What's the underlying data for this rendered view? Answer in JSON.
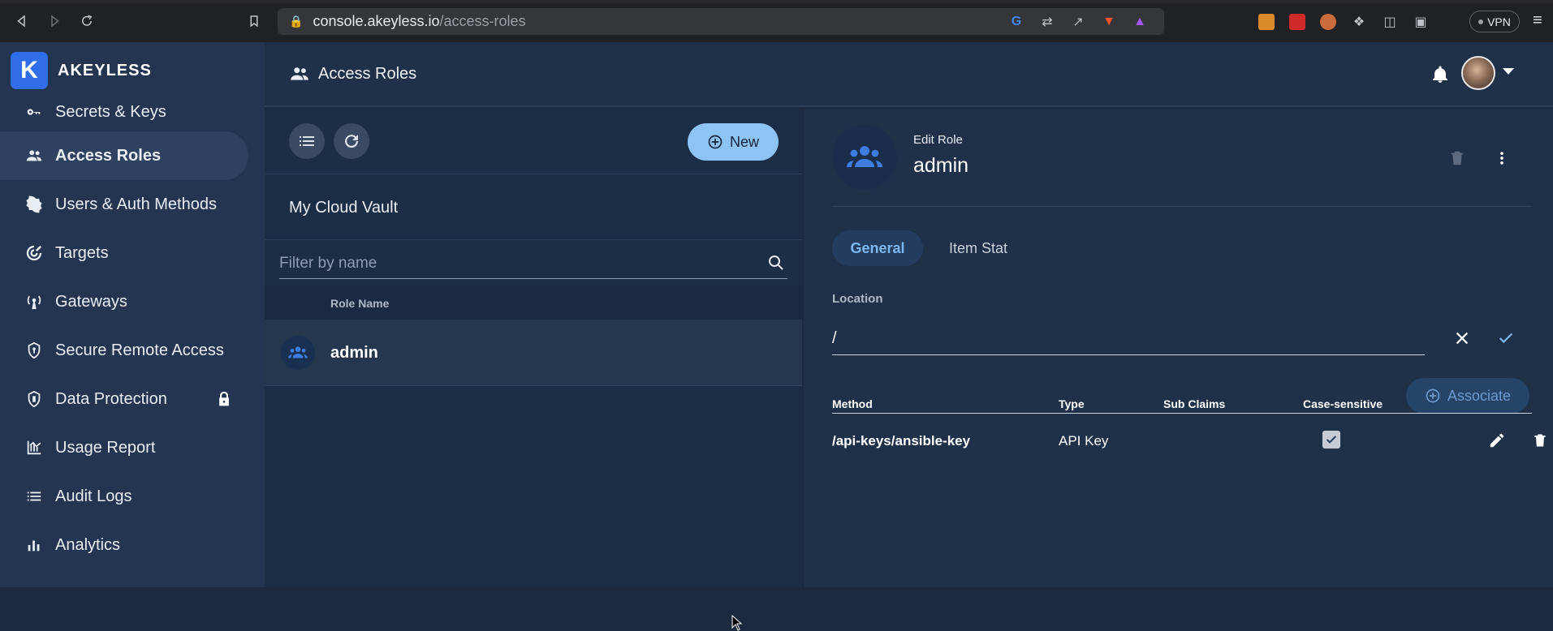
{
  "browser": {
    "url_host": "console.akeyless.io",
    "url_path": "/access-roles",
    "vpn_label": "VPN"
  },
  "brand": {
    "logo_letter": "K",
    "name": "AKEYLESS"
  },
  "sidebar": {
    "items": [
      {
        "label": "Secrets & Keys",
        "icon": "key-icon"
      },
      {
        "label": "Access Roles",
        "icon": "people-icon",
        "active": true
      },
      {
        "label": "Users & Auth Methods",
        "icon": "user-badge-icon"
      },
      {
        "label": "Targets",
        "icon": "target-icon"
      },
      {
        "label": "Gateways",
        "icon": "gateway-icon"
      },
      {
        "label": "Secure Remote Access",
        "icon": "shield-key-icon"
      },
      {
        "label": "Data Protection",
        "icon": "shield-icon",
        "locked": true
      },
      {
        "label": "Usage Report",
        "icon": "chart-icon"
      },
      {
        "label": "Audit Logs",
        "icon": "list-icon"
      },
      {
        "label": "Analytics",
        "icon": "bar-chart-icon"
      }
    ]
  },
  "header": {
    "title": "Access Roles"
  },
  "list_panel": {
    "new_label": "New",
    "vault_name": "My Cloud Vault",
    "filter_placeholder": "Filter by name",
    "column_header": "Role Name",
    "rows": [
      {
        "name": "admin"
      }
    ]
  },
  "detail": {
    "edit_label": "Edit Role",
    "role_name": "admin",
    "tabs": [
      "General",
      "Item Stat"
    ],
    "location_label": "Location",
    "location_value": "/",
    "associate_label": "Associate",
    "table": {
      "headers": [
        "Method",
        "Type",
        "Sub Claims",
        "Case-sensitive"
      ],
      "rows": [
        {
          "method": "/api-keys/ansible-key",
          "type": "API Key",
          "sub_claims": "",
          "case_sensitive": true
        }
      ]
    }
  },
  "colors": {
    "accent": "#8dc4f5",
    "sidebar_bg": "#233550",
    "panel_bg": "#1f3049"
  }
}
